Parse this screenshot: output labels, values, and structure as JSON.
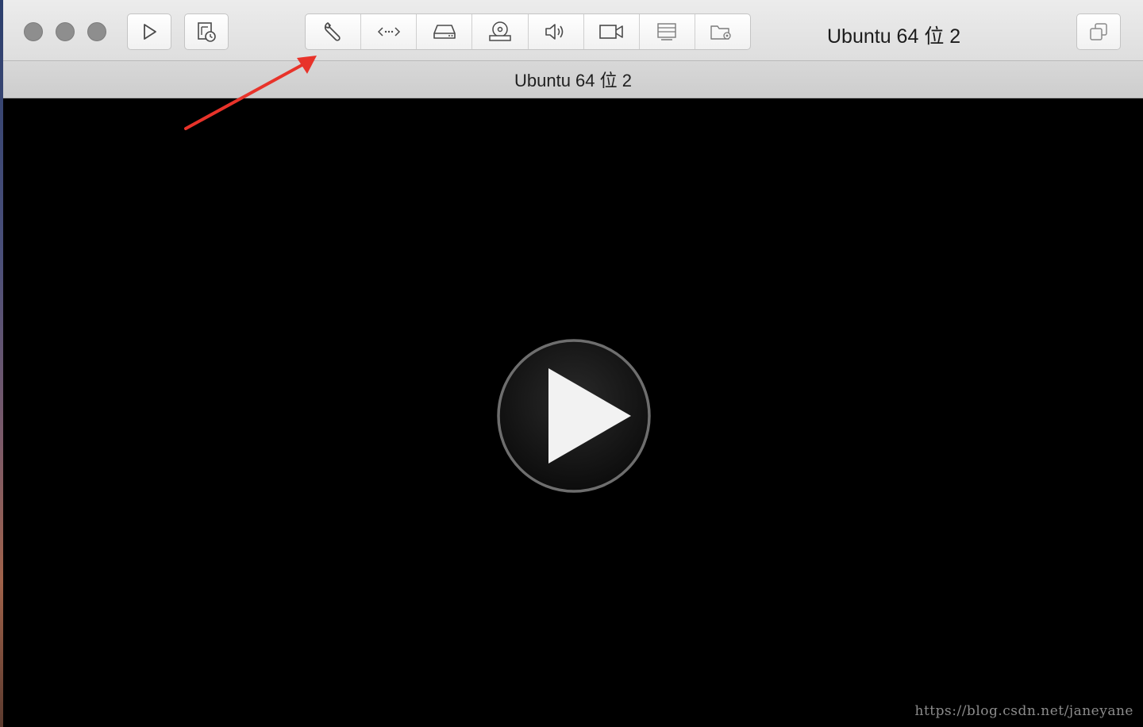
{
  "window": {
    "title": "Ubuntu 64 位 2"
  },
  "tab": {
    "label": "Ubuntu 64 位 2"
  },
  "toolbar": {
    "left_buttons": [
      {
        "icon": "play-icon"
      },
      {
        "icon": "snapshot-icon"
      }
    ],
    "device_buttons": [
      {
        "icon": "wrench-icon"
      },
      {
        "icon": "network-arrows-icon"
      },
      {
        "icon": "hard-disk-icon"
      },
      {
        "icon": "optical-drive-icon"
      },
      {
        "icon": "speaker-icon"
      },
      {
        "icon": "camera-icon"
      },
      {
        "icon": "printer-icon"
      },
      {
        "icon": "shared-folder-icon"
      }
    ],
    "right_button": {
      "icon": "fullscreen-copy-icon"
    }
  },
  "vm_display": {
    "center_icon": "play-circle-icon"
  },
  "annotation": {
    "arrow_color": "#e8332a"
  },
  "watermark": {
    "text": "https://blog.csdn.net/janeyane"
  }
}
